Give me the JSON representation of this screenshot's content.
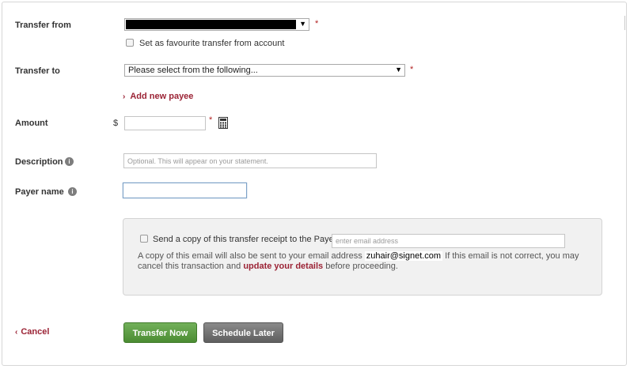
{
  "transfer_from": {
    "label": "Transfer from",
    "required_mark": "*",
    "favourite_label": "Set as favourite transfer from account"
  },
  "transfer_to": {
    "label": "Transfer to",
    "selected": "Please select from the following...",
    "required_mark": "*",
    "add_payee": "Add new payee"
  },
  "amount": {
    "label": "Amount",
    "currency": "$",
    "value": "",
    "required_mark": "*"
  },
  "description": {
    "label": "Description",
    "placeholder": "Optional. This will appear on your statement."
  },
  "payer_name": {
    "label": "Payer name",
    "value": ""
  },
  "receipt": {
    "checkbox_label": "Send a copy of this transfer receipt to the Payee.",
    "email_placeholder": "enter email address",
    "note_start": "A copy of this email will also be sent to your email address",
    "user_email": "zuhair@signet.com",
    "note_end": "If this email is not correct, you may",
    "note_line2_start": "cancel this transaction and",
    "update_link": "update your details",
    "note_line2_end": "before proceeding."
  },
  "actions": {
    "cancel": "Cancel",
    "transfer_now": "Transfer Now",
    "schedule_later": "Schedule Later"
  },
  "icons": {
    "info": "info-icon",
    "calculator": "calculator-icon",
    "dropdown": "chevron-down-icon",
    "link_chevron": "chevron-right-icon",
    "cancel_chevron": "chevron-left-icon"
  },
  "colors": {
    "link": "#9b2335",
    "required": "#b22222",
    "primary_button": "#5a9e3f",
    "secondary_button": "#6e6e6e",
    "panel_bg": "#f1f1f1"
  }
}
